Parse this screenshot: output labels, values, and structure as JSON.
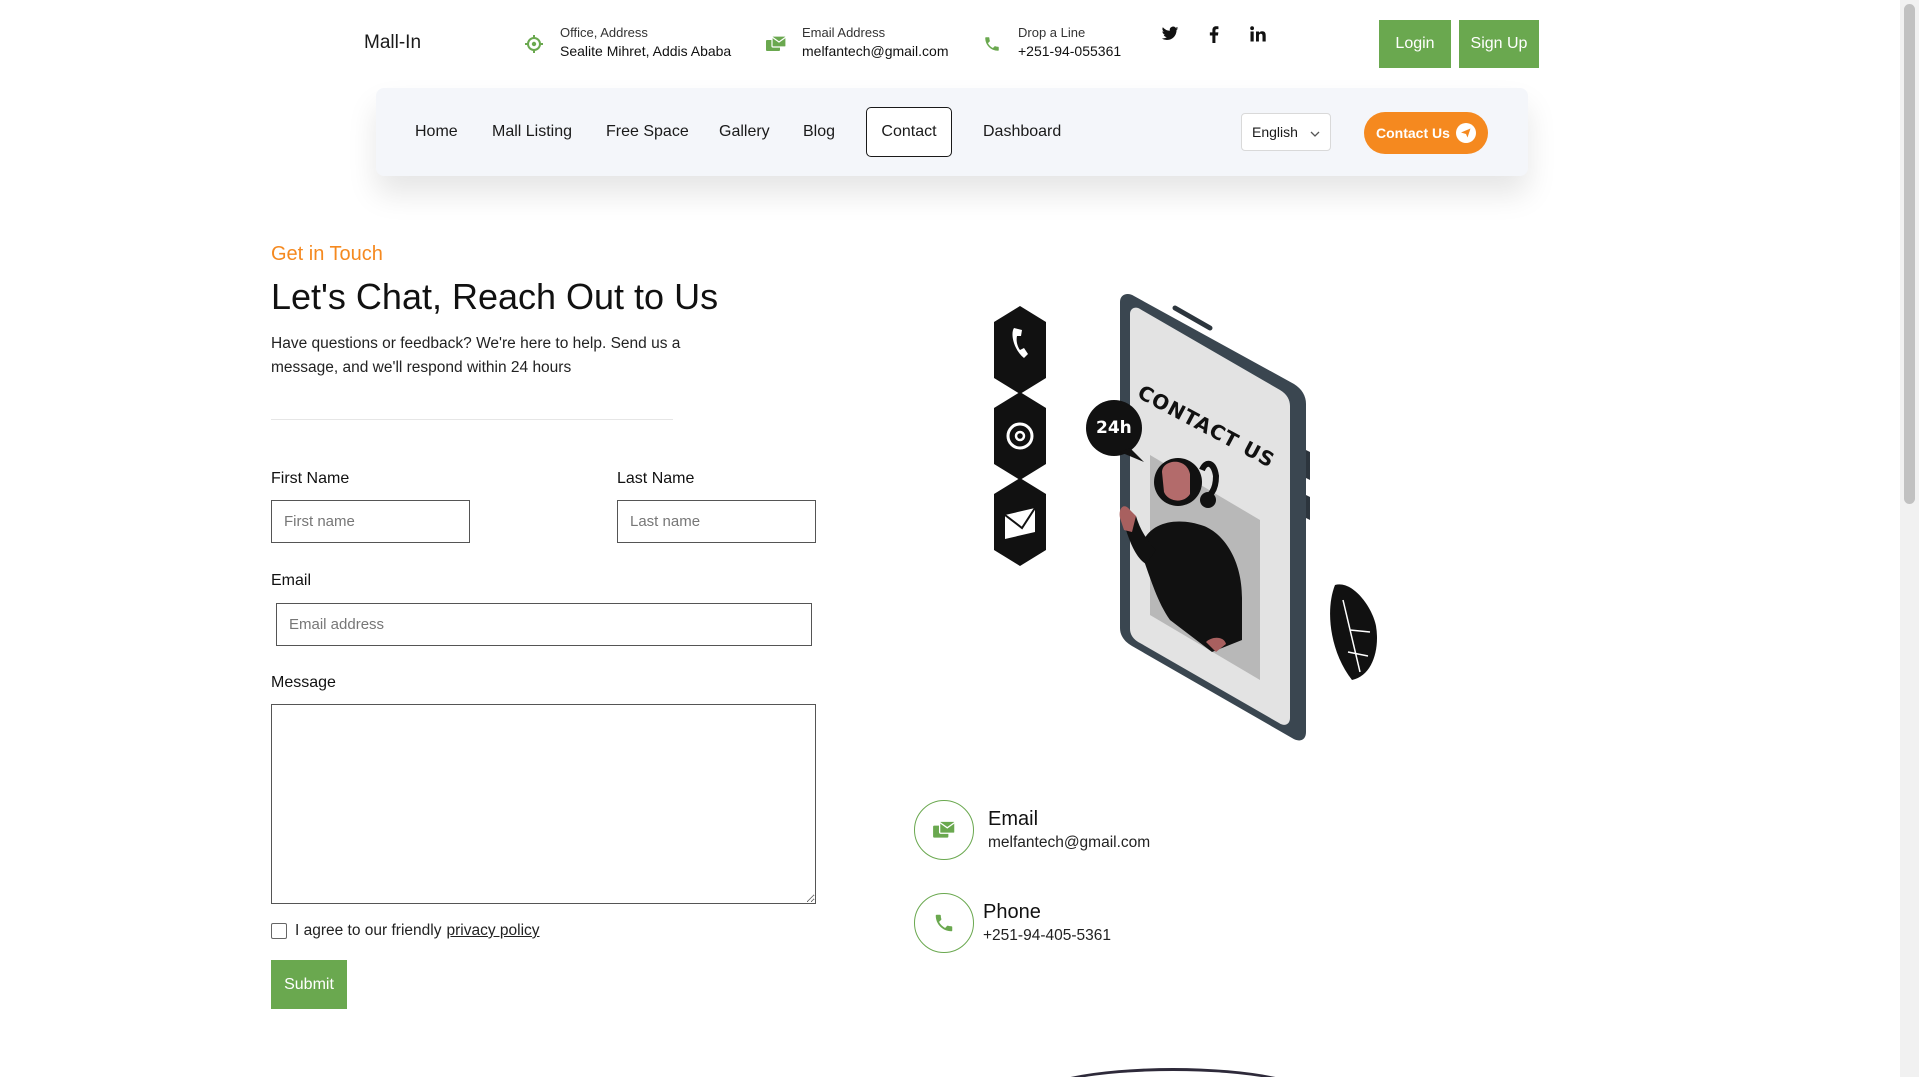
{
  "header": {
    "brand": "Mall-In",
    "office": {
      "label": "Office, Address",
      "value": "Sealite Mihret, Addis Ababa",
      "icon": "location-target-icon"
    },
    "email": {
      "label": "Email Address",
      "value": "melfantech@gmail.com",
      "icon": "mail-icon"
    },
    "phone": {
      "label": "Drop a Line",
      "value": "+251-94-055361",
      "icon": "phone-icon"
    },
    "socials": [
      "twitter-icon",
      "facebook-icon",
      "linkedin-icon"
    ],
    "login_label": "Login",
    "signup_label": "Sign Up"
  },
  "nav": {
    "items": [
      "Home",
      "Mall Listing",
      "Free Space",
      "Gallery",
      "Blog",
      "Contact",
      "Dashboard"
    ],
    "active": "Contact",
    "language": "English",
    "contact_us_label": "Contact Us"
  },
  "hero": {
    "eyebrow": "Get in Touch",
    "title": "Let's Chat, Reach Out to Us",
    "lead": "Have questions or feedback? We're here to help. Send us a message, and we'll respond within 24 hours"
  },
  "form": {
    "first_name_label": "First Name",
    "first_name_placeholder": "First name",
    "last_name_label": "Last Name",
    "last_name_placeholder": "Last name",
    "email_label": "Email",
    "email_placeholder": "Email address",
    "message_label": "Message",
    "agree_text": "I agree to our friendly",
    "privacy_link": "privacy policy",
    "submit_label": "Submit"
  },
  "illustration": {
    "phone_text": "CONTACT US",
    "bubble_text": "24h"
  },
  "contact": {
    "email_title": "Email",
    "email_value": "melfantech@gmail.com",
    "phone_title": "Phone",
    "phone_value": "+251-94-405-5361"
  },
  "colors": {
    "accent_green": "#6aa84f",
    "accent_orange": "#f5891f",
    "nav_bg": "#f4f6fa"
  }
}
